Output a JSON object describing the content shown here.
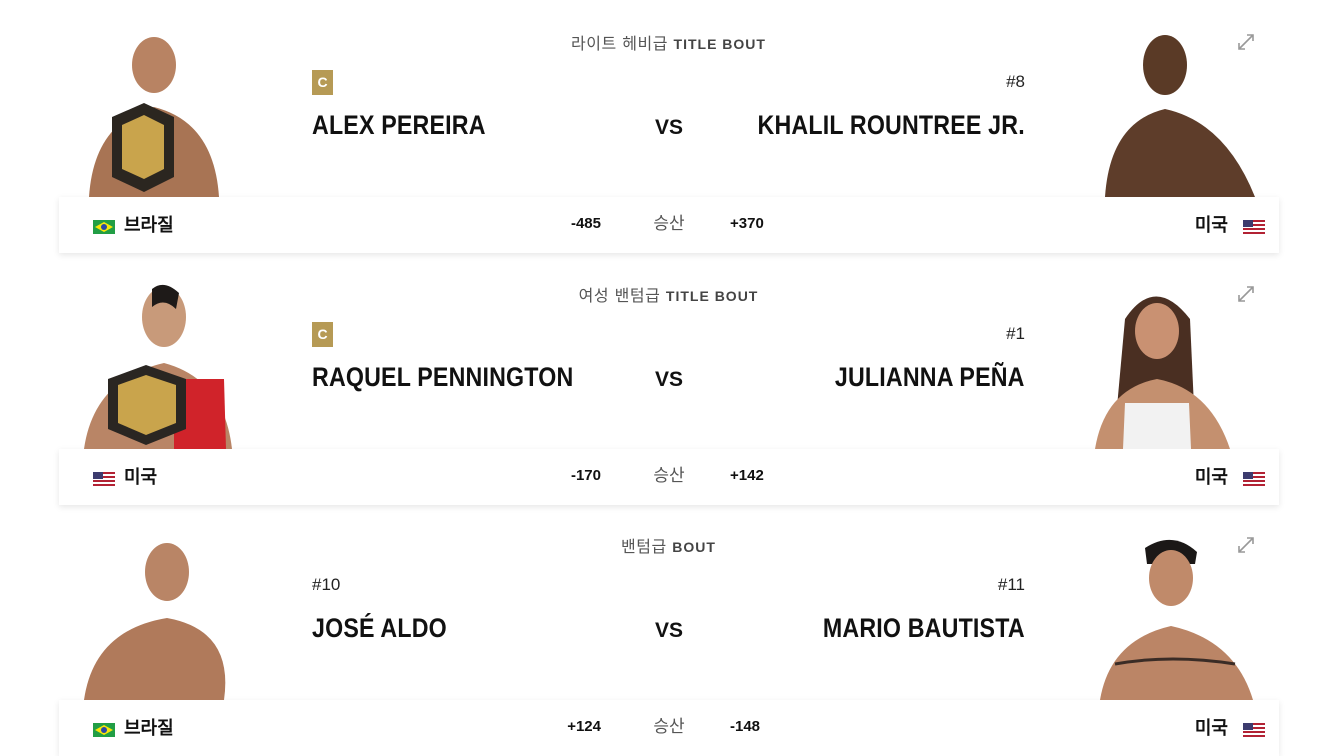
{
  "fights": [
    {
      "weight_class": "라이트 헤비급",
      "bout_label": "TITLE BOUT",
      "red": {
        "tag": "C",
        "name": "ALEX PEREIRA",
        "country": "브라질",
        "flag": "brazil-flag-icon",
        "odds": "-485"
      },
      "blue": {
        "tag": "#8",
        "name": "KHALIL ROUNTREE JR.",
        "country": "미국",
        "flag": "usa-flag-icon",
        "odds": "+370"
      },
      "vs_label": "VS",
      "odds_label": "승산"
    },
    {
      "weight_class": "여성 밴텀급",
      "bout_label": "TITLE BOUT",
      "red": {
        "tag": "C",
        "name": "RAQUEL PENNINGTON",
        "country": "미국",
        "flag": "usa-flag-icon",
        "odds": "-170"
      },
      "blue": {
        "tag": "#1",
        "name": "JULIANNA PEÑA",
        "country": "미국",
        "flag": "usa-flag-icon",
        "odds": "+142"
      },
      "vs_label": "VS",
      "odds_label": "승산"
    },
    {
      "weight_class": "밴텀급",
      "bout_label": "BOUT",
      "red": {
        "tag": "#10",
        "name": "JOSÉ ALDO",
        "country": "브라질",
        "flag": "brazil-flag-icon",
        "odds": "+124"
      },
      "blue": {
        "tag": "#11",
        "name": "MARIO BAUTISTA",
        "country": "미국",
        "flag": "usa-flag-icon",
        "odds": "-148"
      },
      "vs_label": "VS",
      "odds_label": "승산"
    }
  ],
  "colors": {
    "champion_badge": "#b69a55",
    "text": "#111111",
    "muted": "#555555"
  }
}
